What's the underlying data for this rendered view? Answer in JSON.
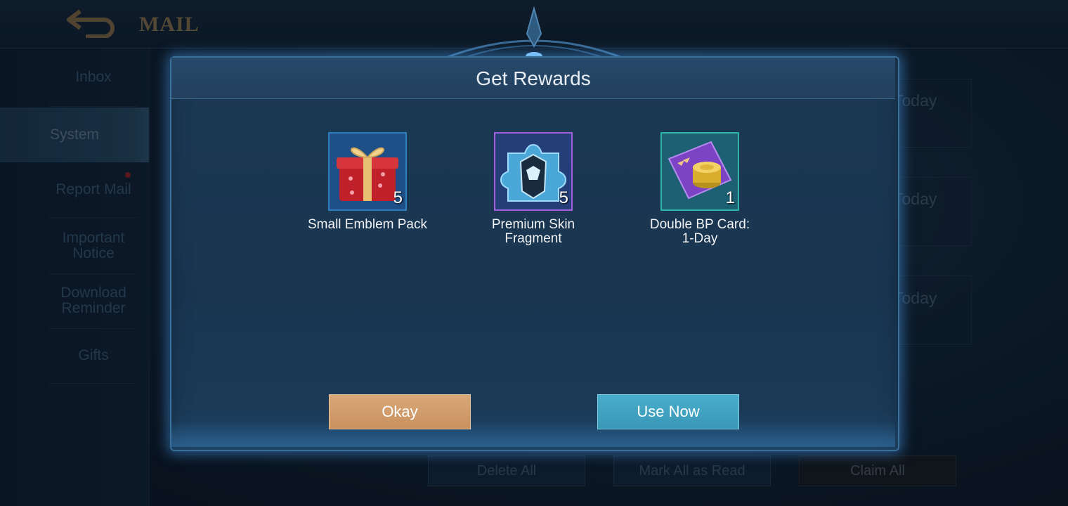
{
  "app": {
    "title": "MAIL"
  },
  "sidebar": {
    "items": [
      {
        "label": "Inbox"
      },
      {
        "label": "System"
      },
      {
        "label": "Report Mail"
      },
      {
        "label": "Important\nNotice"
      },
      {
        "label": "Download\nReminder"
      },
      {
        "label": "Gifts"
      }
    ]
  },
  "mail_list": {
    "dates": [
      "Today",
      "Today",
      "Today"
    ]
  },
  "bottom_actions": {
    "delete_all": "Delete All",
    "mark_all_read": "Mark All as Read",
    "claim_all": "Claim All"
  },
  "dialog": {
    "title": "Get Rewards",
    "rewards": [
      {
        "name": "Small Emblem Pack",
        "quantity": "5",
        "icon": "gift-box-icon"
      },
      {
        "name": "Premium Skin\nFragment",
        "quantity": "5",
        "icon": "skin-fragment-icon"
      },
      {
        "name": "Double BP Card:\n1-Day",
        "quantity": "1",
        "icon": "bp-card-icon"
      }
    ],
    "okay_label": "Okay",
    "use_now_label": "Use Now"
  },
  "colors": {
    "okay_button": "#c8915e",
    "use_now_button": "#3a97b6",
    "title_text": "#7f6a45"
  }
}
